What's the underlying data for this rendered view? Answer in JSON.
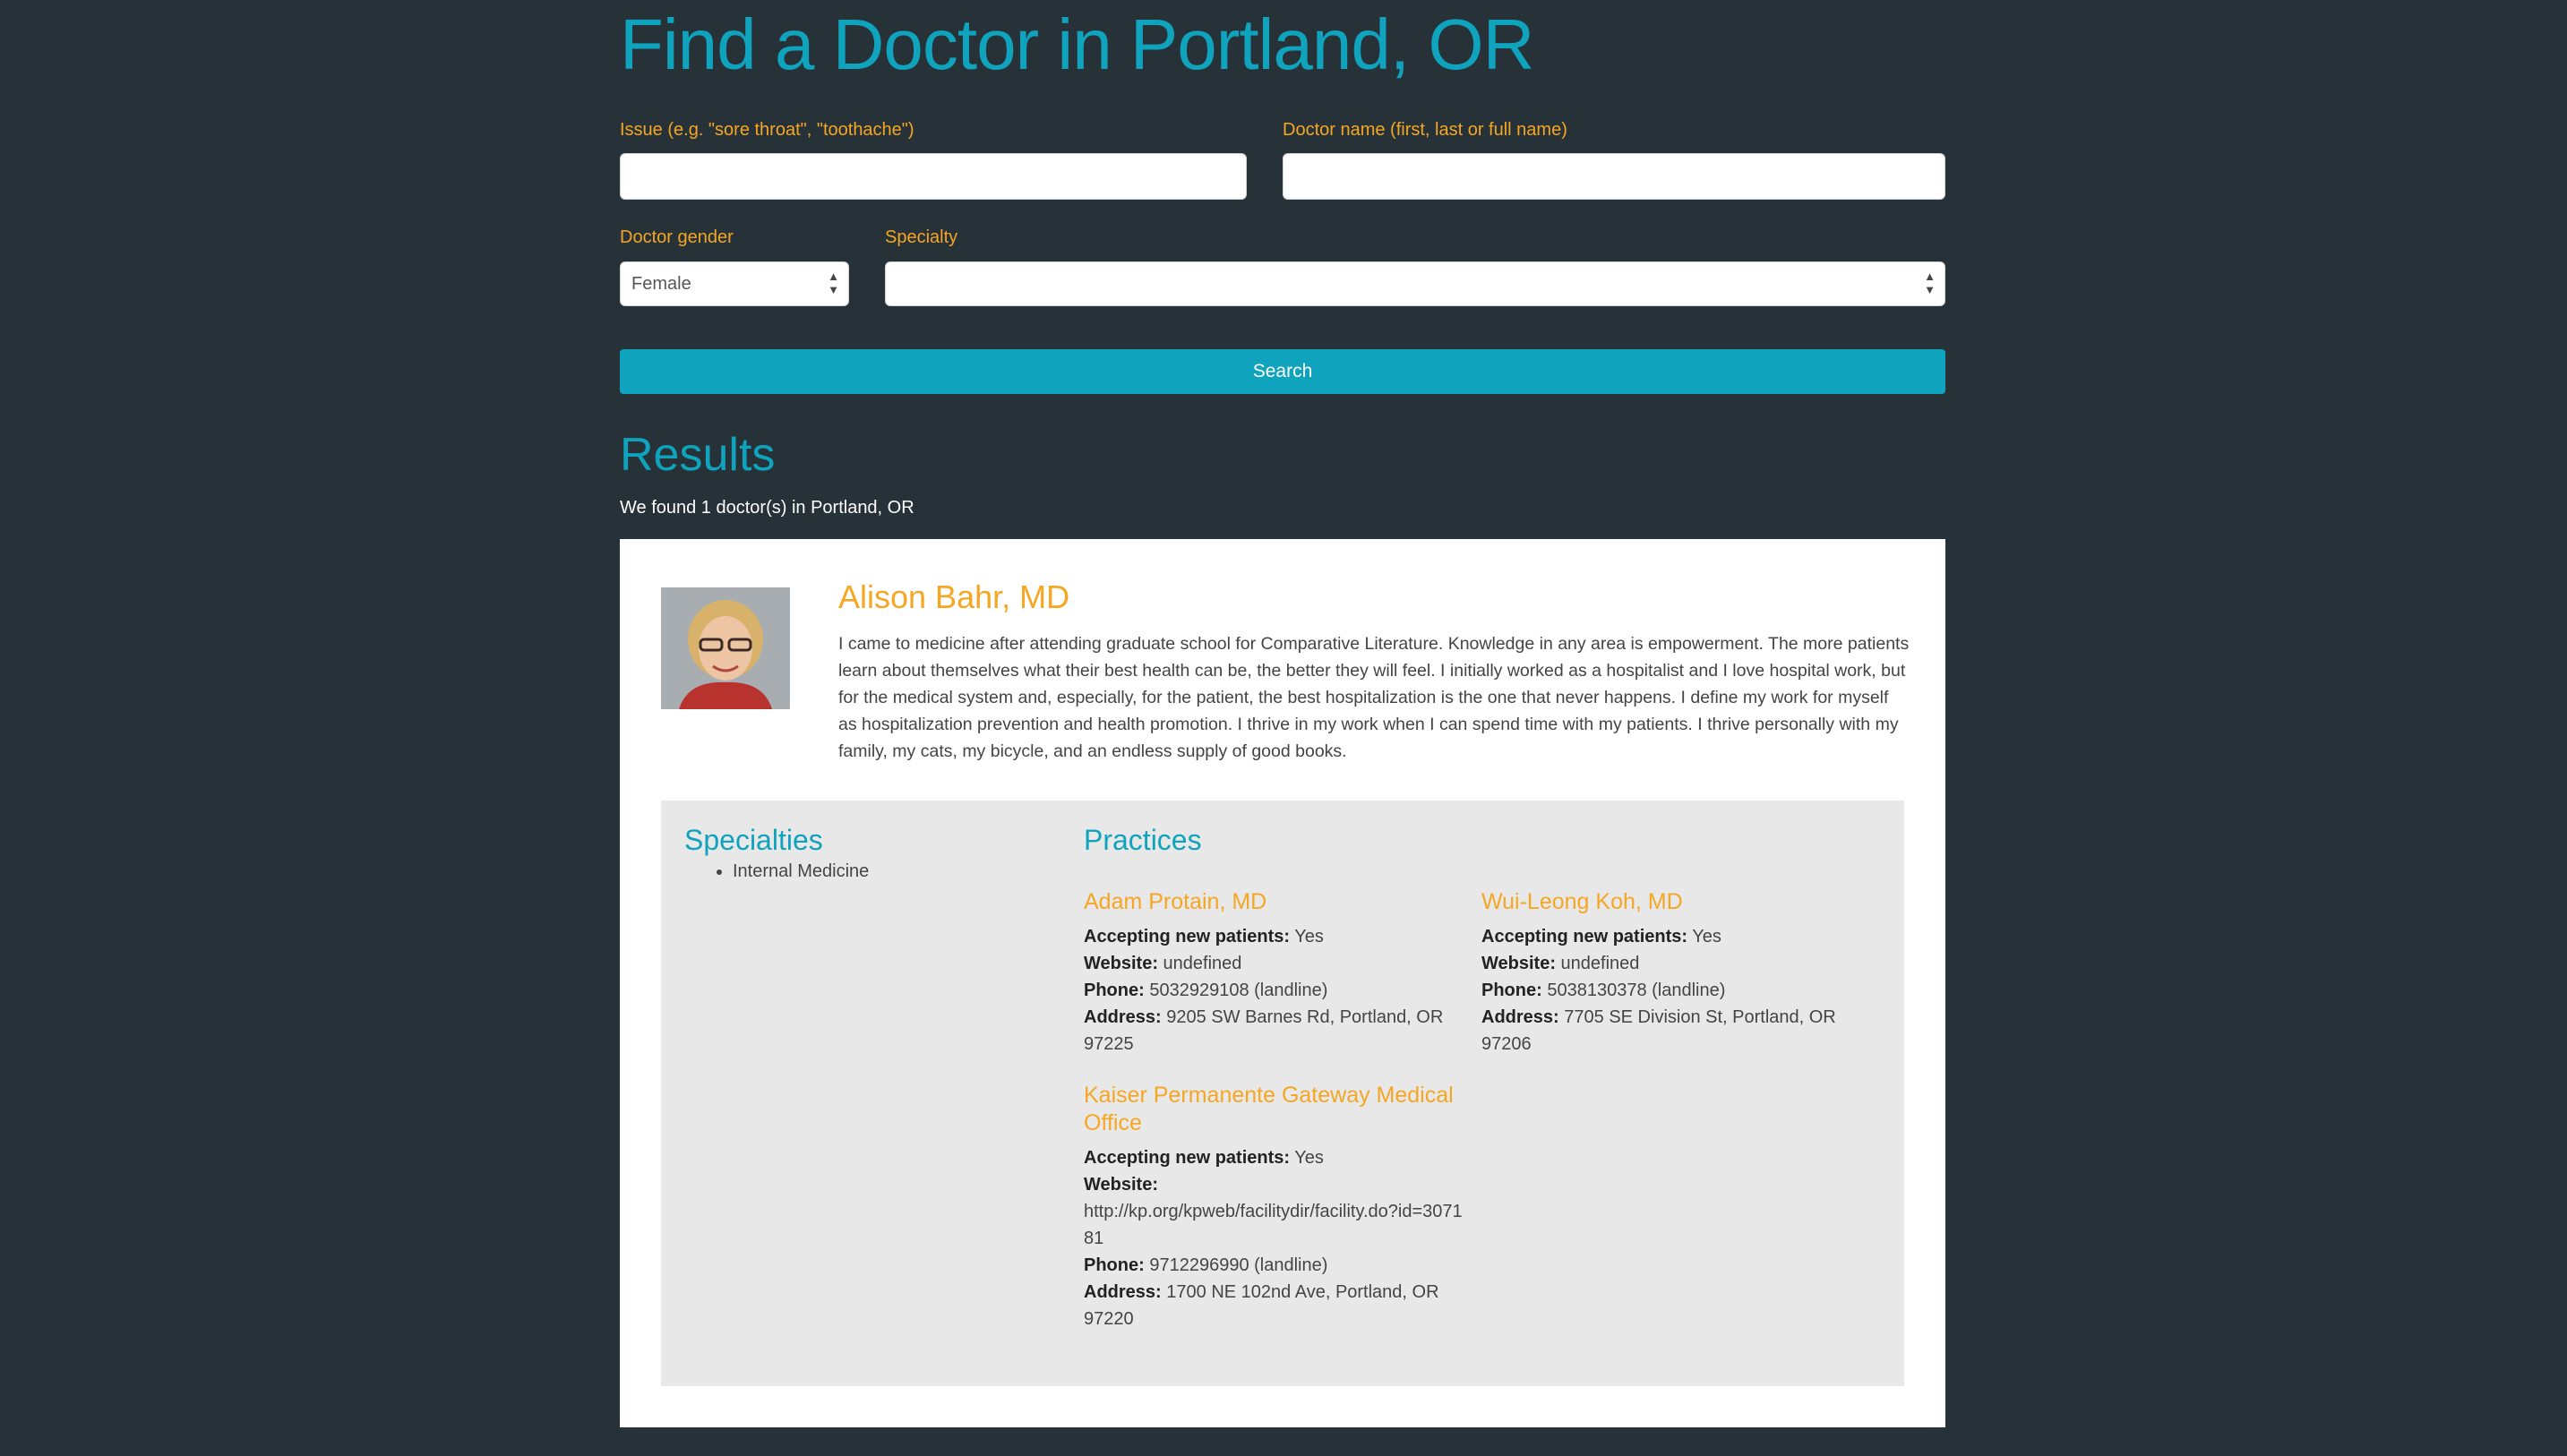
{
  "page_title": "Find a Doctor in Portland, OR",
  "form": {
    "issue_label": "Issue (e.g. \"sore throat\", \"toothache\")",
    "issue_value": "",
    "doctor_name_label": "Doctor name (first, last or full name)",
    "doctor_name_value": "",
    "gender_label": "Doctor gender",
    "gender_value": "Female",
    "specialty_label": "Specialty",
    "specialty_value": "",
    "search_label": "Search"
  },
  "results": {
    "title": "Results",
    "summary": "We found 1 doctor(s) in Portland, OR"
  },
  "doctor": {
    "name": "Alison Bahr, MD",
    "bio": "I came to medicine after attending graduate school for Comparative Literature. Knowledge in any area is empowerment. The more patients learn about themselves what their best health can be, the better they will feel. I initially worked as a hospitalist and I love hospital work, but for the medical system and, especially, for the patient, the best hospitalization is the one that never happens. I define my work for myself as hospitalization prevention and health promotion. I thrive in my work when I can spend time with my patients. I thrive personally with my family, my cats, my bicycle, and an endless supply of good books.",
    "specialties_title": "Specialties",
    "specialties": [
      "Internal Medicine"
    ],
    "practices_title": "Practices",
    "practices": [
      {
        "name": "Adam Protain, MD",
        "accepting_label": "Accepting new patients:",
        "accepting": "Yes",
        "website_label": "Website:",
        "website": "undefined",
        "phone_label": "Phone:",
        "phone": "5032929108 (landline)",
        "address_label": "Address:",
        "address": "9205 SW Barnes Rd, Portland, OR 97225"
      },
      {
        "name": "Wui-Leong Koh, MD",
        "accepting_label": "Accepting new patients:",
        "accepting": "Yes",
        "website_label": "Website:",
        "website": "undefined",
        "phone_label": "Phone:",
        "phone": "5038130378 (landline)",
        "address_label": "Address:",
        "address": "7705 SE Division St, Portland, OR 97206"
      },
      {
        "name": "Kaiser Permanente Gateway Medical Office",
        "accepting_label": "Accepting new patients:",
        "accepting": "Yes",
        "website_label": "Website:",
        "website": "http://kp.org/kpweb/facilitydir/facility.do?id=307181",
        "phone_label": "Phone:",
        "phone": "9712296990 (landline)",
        "address_label": "Address:",
        "address": "1700 NE 102nd Ave, Portland, OR 97220"
      }
    ]
  }
}
